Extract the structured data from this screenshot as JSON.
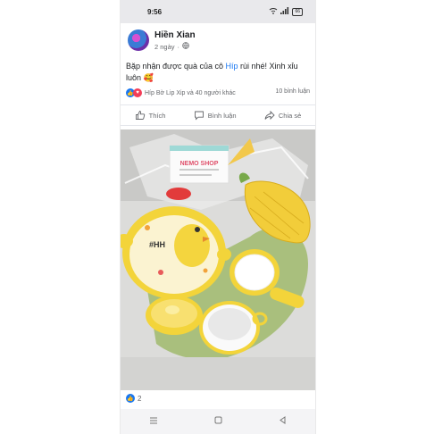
{
  "status": {
    "time": "9:56",
    "battery": "66"
  },
  "post": {
    "author": "Hiền Xian",
    "time": "2 ngày",
    "text_before": "Bặp nhận được quà của cô ",
    "mention": "Híp",
    "text_after": " rùi nhé! Xinh xỉu luôn 🥰"
  },
  "reactions": {
    "names": "Híp Bờ Lip Xip và 40 người khác",
    "comments": "10 bình luận"
  },
  "actions": {
    "like": "Thích",
    "comment": "Bình luận",
    "share": "Chia sẻ"
  },
  "photo": {
    "card_title": "NEMO SHOP",
    "bowl_text": "#HH"
  },
  "footer": {
    "like_count": "2"
  },
  "colors": {
    "accent": "#1877f2",
    "love": "#f33e58",
    "bowl_yellow": "#f3d43a"
  }
}
